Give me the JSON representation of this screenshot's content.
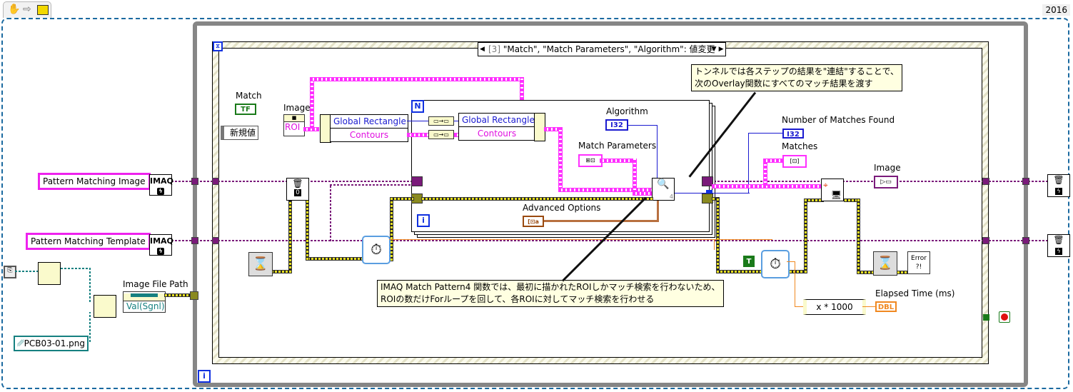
{
  "toolbar": {
    "icons": [
      "hand-icon",
      "arrow-icon",
      "vi-icon"
    ],
    "version": "2016"
  },
  "event_structure": {
    "case_index": "[3]",
    "case_label": "\"Match\", \"Match Parameters\", \"Algorithm\": 値変更",
    "new_value_label": "新規値"
  },
  "left_panel": {
    "image_refnum_label": "Pattern Matching Image",
    "template_refnum_label": "Pattern Matching Template",
    "imaq_label": "IMAQ",
    "file_constant": "PCB03-01.png",
    "image_file_path_label": "Image File Path",
    "val_sgnl_label": "Val(Sgnl)"
  },
  "controls": {
    "match_label": "Match",
    "match_type": "TF",
    "image_label": "Image",
    "roi_label": "ROI",
    "algorithm_label": "Algorithm",
    "algorithm_type": "I32",
    "match_params_label": "Match Parameters",
    "advanced_options_label": "Advanced Options",
    "advanced_type": "[⊡a"
  },
  "unbundle": {
    "row1": "Global Rectangle",
    "row2": "Contours"
  },
  "for_loop": {
    "count_terminal": "N",
    "iteration_terminal": "i",
    "match_vi_suffix": "4"
  },
  "outputs": {
    "num_matches_label": "Number of Matches Found",
    "num_matches_type": "I32",
    "matches_label": "Matches",
    "image_label": "Image",
    "elapsed_label": "Elapsed Time (ms)",
    "elapsed_type": "DBL",
    "multiply_label": "x * 1000",
    "true_constant": "T",
    "error_label": "Error ?!"
  },
  "notes": {
    "tunnel_note": [
      "トンネルでは各ステップの結果を\"連結\"することで、",
      "次のOverlay関数にすべてのマッチ結果を渡す"
    ],
    "match_note": [
      "IMAQ Match Pattern4 関数では、最初に描かれたROIしかマッチ検索を行わないため、",
      "ROIの数だけForループを回して、各ROIに対してマッチ検索を行わせる"
    ]
  },
  "while_loop": {
    "iteration_terminal": "i"
  }
}
